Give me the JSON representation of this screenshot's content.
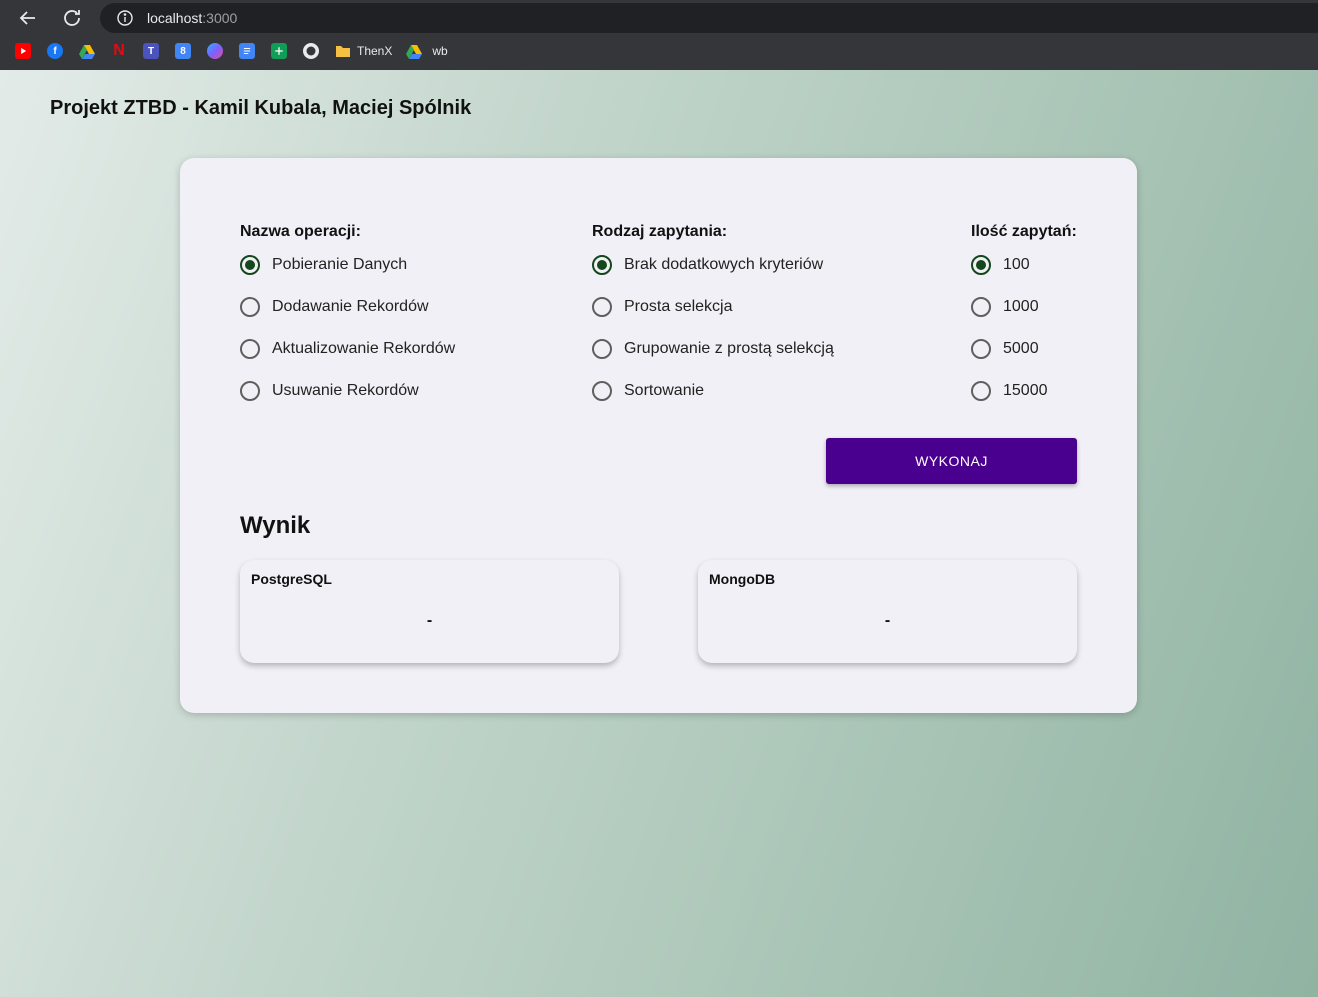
{
  "browser": {
    "url_host": "localhost",
    "url_port": ":3000",
    "bookmarks": [
      {
        "icon": "youtube-icon",
        "color": "#ff0000"
      },
      {
        "icon": "facebook-icon",
        "color": "#1877f2"
      },
      {
        "icon": "google-drive-icon",
        "color": "#34a853"
      },
      {
        "icon": "netflix-icon",
        "color": "#e50914"
      },
      {
        "icon": "teams-icon",
        "color": "#4b53bc"
      },
      {
        "icon": "google-calendar-icon",
        "color": "#4285f4"
      },
      {
        "icon": "copilot-icon",
        "color": "#7b61ff"
      },
      {
        "icon": "google-docs-icon",
        "color": "#4285f4"
      },
      {
        "icon": "google-sheets-icon",
        "color": "#0f9d58"
      },
      {
        "icon": "github-icon",
        "color": "#e8eaed"
      }
    ],
    "bookmark_folder_label": "ThenX",
    "bookmark_drive_label": "wb"
  },
  "page": {
    "title": "Projekt ZTBD - Kamil Kubala, Maciej Spólnik"
  },
  "operation": {
    "label": "Nazwa operacji:",
    "options": [
      "Pobieranie Danych",
      "Dodawanie Rekordów",
      "Aktualizowanie Rekordów",
      "Usuwanie Rekordów"
    ],
    "selected": 0
  },
  "query_type": {
    "label": "Rodzaj zapytania:",
    "options": [
      "Brak dodatkowych kryteriów",
      "Prosta selekcja",
      "Grupowanie z prostą selekcją",
      "Sortowanie"
    ],
    "selected": 0
  },
  "query_count": {
    "label": "Ilość zapytań:",
    "options": [
      "100",
      "1000",
      "5000",
      "15000"
    ],
    "selected": 0
  },
  "execute_label": "WYKONAJ",
  "results": {
    "heading": "Wynik",
    "postgres": {
      "title": "PostgreSQL",
      "value": "-"
    },
    "mongo": {
      "title": "MongoDB",
      "value": "-"
    }
  },
  "colors": {
    "accent": "#4a008e",
    "radio_checked": "#14471b"
  }
}
